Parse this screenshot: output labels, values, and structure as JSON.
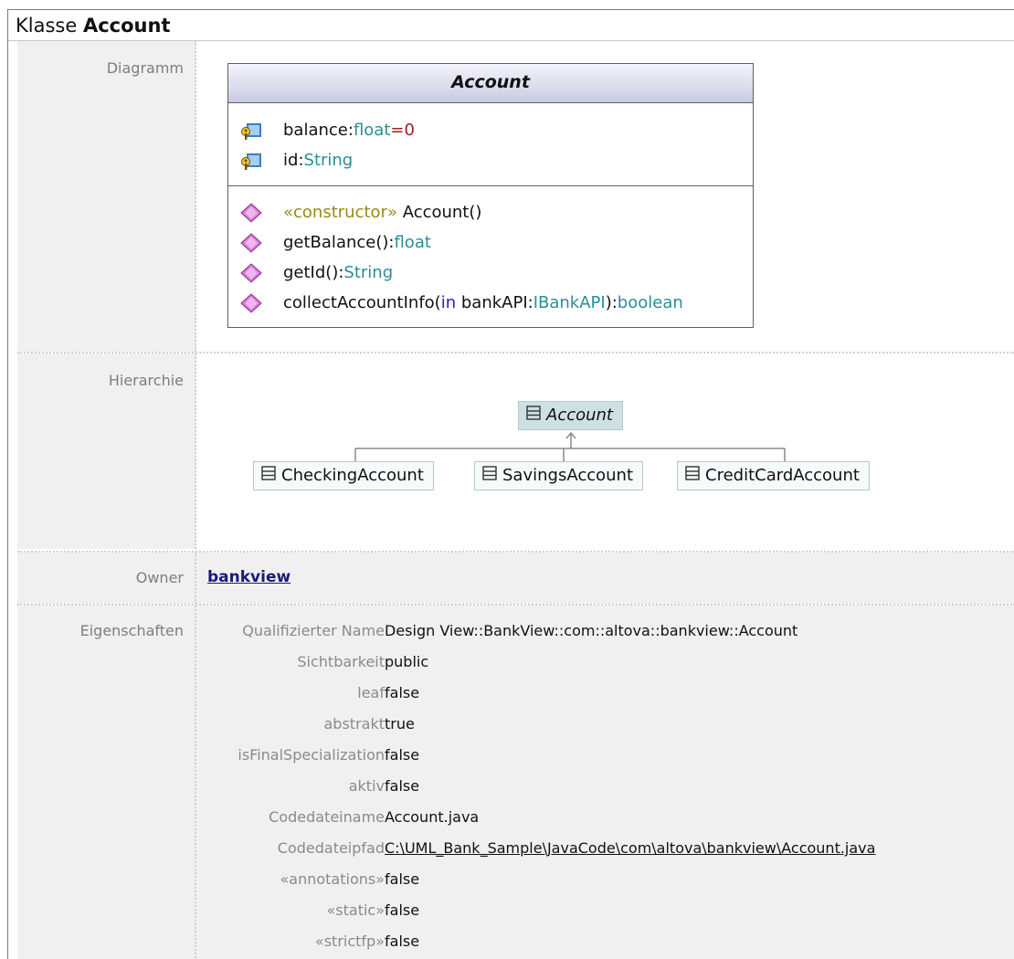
{
  "header": {
    "prefix": "Klasse",
    "name": "Account"
  },
  "labels": {
    "diagram": "Diagramm",
    "hierarchy": "Hierarchie",
    "owner": "Owner",
    "properties": "Eigenschaften"
  },
  "uml_class": {
    "name": "Account",
    "attributes": [
      {
        "name": "balance",
        "sep": ":",
        "type": "float",
        "eq": "=",
        "default": "0",
        "icon": "protected-attribute-icon"
      },
      {
        "name": "id",
        "sep": ":",
        "type": "String",
        "icon": "protected-attribute-icon"
      }
    ],
    "operations": [
      {
        "stereotype": "«constructor»",
        "name": " Account()",
        "icon": "operation-icon"
      },
      {
        "name": "getBalance():",
        "type": "float",
        "icon": "operation-icon"
      },
      {
        "name": "getId():",
        "type": "String",
        "icon": "operation-icon"
      },
      {
        "name": "collectAccountInfo(",
        "in": "in",
        "param": " bankAPI:",
        "ptype": "IBankAPI",
        "close": "):",
        "type": "boolean",
        "icon": "operation-icon"
      }
    ]
  },
  "hierarchy": {
    "base": "Account",
    "children": [
      "CheckingAccount",
      "SavingsAccount",
      "CreditCardAccount"
    ]
  },
  "owner": {
    "value": "bankview"
  },
  "properties": [
    {
      "key": "Qualifizierter Name",
      "value": "Design View::BankView::com::altova::bankview::Account"
    },
    {
      "key": "Sichtbarkeit",
      "value": "public"
    },
    {
      "key": "leaf",
      "value": "false"
    },
    {
      "key": "abstrakt",
      "value": "true"
    },
    {
      "key": "isFinalSpecialization",
      "value": "false"
    },
    {
      "key": "aktiv",
      "value": "false"
    },
    {
      "key": "Codedateiname",
      "value": "Account.java"
    },
    {
      "key": "Codedateipfad",
      "value": "C:\\UML_Bank_Sample\\JavaCode\\com\\altova\\bankview\\Account.java"
    },
    {
      "key": "«annotations»",
      "value": "false"
    },
    {
      "key": "«static»",
      "value": "false"
    },
    {
      "key": "«strictfp»",
      "value": "false"
    }
  ],
  "colors": {
    "label_bg": "#f0f0f0",
    "type": "#2a8d96",
    "stereotype": "#9a8a12",
    "keyword_in": "#3a18c8",
    "default_value": "#a02020"
  }
}
